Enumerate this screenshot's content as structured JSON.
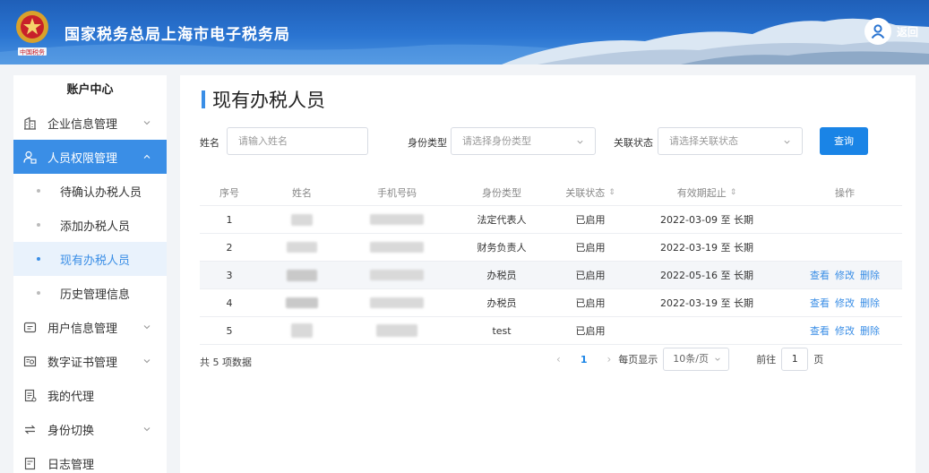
{
  "header": {
    "site_title": "国家税务总局上海市电子税务局",
    "back_label": "返回",
    "emblem_text": "中国税务"
  },
  "sidebar": {
    "title": "账户中心",
    "items": [
      {
        "label": "企业信息管理",
        "icon": "building-icon",
        "expandable": true
      },
      {
        "label": "人员权限管理",
        "icon": "user-lock-icon",
        "expandable": true,
        "active": true
      },
      {
        "label": "用户信息管理",
        "icon": "id-card-icon",
        "expandable": true
      },
      {
        "label": "数字证书管理",
        "icon": "certificate-icon",
        "expandable": true
      },
      {
        "label": "我的代理",
        "icon": "document-icon",
        "expandable": false
      },
      {
        "label": "身份切换",
        "icon": "switch-icon",
        "expandable": true
      },
      {
        "label": "日志管理",
        "icon": "log-icon",
        "expandable": false
      }
    ],
    "sub_items": [
      {
        "label": "待确认办税人员"
      },
      {
        "label": "添加办税人员"
      },
      {
        "label": "现有办税人员",
        "current": true
      },
      {
        "label": "历史管理信息"
      }
    ]
  },
  "main": {
    "title": "现有办税人员",
    "filter": {
      "name_label": "姓名",
      "name_placeholder": "请输入姓名",
      "type_label": "身份类型",
      "type_placeholder": "请选择身份类型",
      "status_label": "关联状态",
      "status_placeholder": "请选择关联状态",
      "query_label": "查询"
    },
    "table": {
      "columns": [
        "序号",
        "姓名",
        "手机号码",
        "身份类型",
        "关联状态",
        "有效期起止",
        "操作"
      ],
      "rows": [
        {
          "no": "1",
          "type": "法定代表人",
          "status": "已启用",
          "valid": "2022-03-09 至 长期",
          "ops": []
        },
        {
          "no": "2",
          "type": "财务负责人",
          "status": "已启用",
          "valid": "2022-03-19 至 长期",
          "ops": []
        },
        {
          "no": "3",
          "type": "办税员",
          "status": "已启用",
          "valid": "2022-05-16 至 长期",
          "ops": [
            "查看",
            "修改",
            "删除"
          ]
        },
        {
          "no": "4",
          "type": "办税员",
          "status": "已启用",
          "valid": "2022-03-19 至 长期",
          "ops": [
            "查看",
            "修改",
            "删除"
          ]
        },
        {
          "no": "5",
          "type": "test",
          "status": "已启用",
          "valid": "",
          "ops": [
            "查看",
            "修改",
            "删除"
          ]
        }
      ]
    },
    "footer": {
      "total": "共 5 项数据",
      "page": "1",
      "per_page_label": "每页显示",
      "page_size": "10条/页",
      "goto_label": "前往",
      "goto_value": "1",
      "page_unit": "页"
    }
  },
  "colors": {
    "accent": "#3a8ee6",
    "button": "#1a84e6",
    "header": "#2a74d1"
  }
}
